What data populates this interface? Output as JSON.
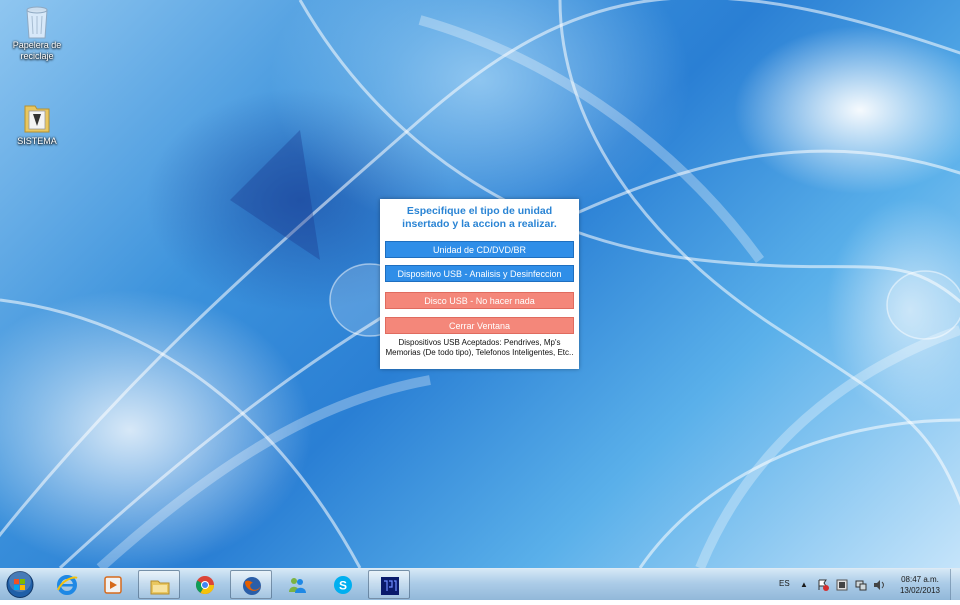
{
  "desktop": {
    "icons": [
      {
        "label": "Papelera de reciclaje",
        "icon": "recycle-bin-icon"
      },
      {
        "label": "SISTEMA",
        "icon": "folder-icon"
      }
    ]
  },
  "dialog": {
    "title": "Especifique el tipo de unidad insertado y la accion a realizar.",
    "buttons": [
      {
        "label": "Unidad de CD/DVD/BR",
        "color": "#2f8ee8"
      },
      {
        "label": "Dispositivo USB - Analisis y Desinfeccion",
        "color": "#2f8ee8"
      },
      {
        "label": "Disco USB - No hacer nada",
        "color": "#f4877a"
      },
      {
        "label": "Cerrar Ventana",
        "color": "#f4877a"
      }
    ],
    "note": "Dispositivos USB Aceptados: Pendrives, Mp's Memorias (De todo tipo), Telefonos Inteligentes, Etc.."
  },
  "taskbar": {
    "items": [
      {
        "icon": "internet-explorer-icon",
        "open": false
      },
      {
        "icon": "media-player-icon",
        "open": false
      },
      {
        "icon": "file-explorer-icon",
        "open": true
      },
      {
        "icon": "chrome-icon",
        "open": false
      },
      {
        "icon": "firefox-icon",
        "open": true
      },
      {
        "icon": "messenger-icon",
        "open": false
      },
      {
        "icon": "skype-icon",
        "open": false
      },
      {
        "icon": "app-window-icon",
        "open": true
      }
    ],
    "tray": {
      "language": "ES",
      "time": "08:47 a.m.",
      "date": "13/02/2013"
    }
  }
}
